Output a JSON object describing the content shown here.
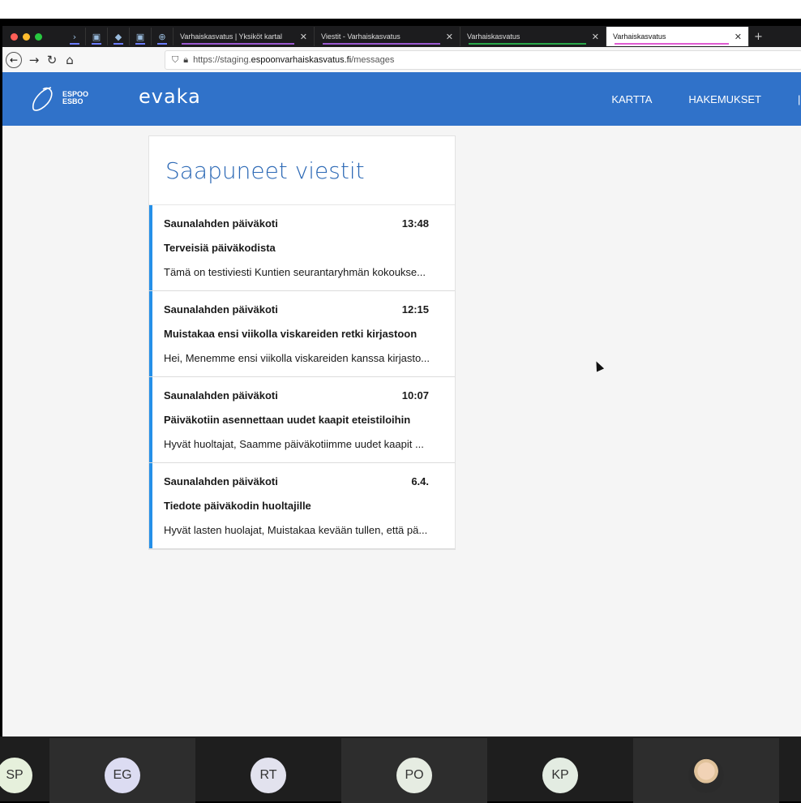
{
  "browser": {
    "tabs": [
      {
        "title": "Varhaiskasvatus | Yksiköt kartal",
        "close": "✕",
        "underline": "#9b59d0"
      },
      {
        "title": "Viestit - Varhaiskasvatus",
        "close": "✕",
        "underline": "#9b59d0"
      },
      {
        "title": "Varhaiskasvatus",
        "close": "✕",
        "underline": "#2aa84a"
      },
      {
        "title": "Varhaiskasvatus",
        "close": "✕",
        "underline": "#e05bd2",
        "active": true
      }
    ],
    "new_tab": "+",
    "url_prefix": "https://staging.",
    "url_domain": "espoonvarhaiskasvatus.fi",
    "url_path": "/messages"
  },
  "app": {
    "logo_line1": "ESPOO",
    "logo_line2": "ESBO",
    "brand": "evaka",
    "nav": [
      "KARTTA",
      "HAKEMUKSET"
    ],
    "accent": "#3072c9"
  },
  "inbox": {
    "title": "Saapuneet viestit",
    "messages": [
      {
        "sender": "Saunalahden päiväkoti",
        "time": "13:48",
        "subject": "Terveisiä päiväkodista",
        "preview": "Tämä on testiviesti Kuntien seurantaryhmän kokoukse..."
      },
      {
        "sender": "Saunalahden päiväkoti",
        "time": "12:15",
        "subject": "Muistakaa ensi viikolla viskareiden retki kirjastoon",
        "preview": "Hei, Menemme ensi viikolla viskareiden kanssa kirjasto..."
      },
      {
        "sender": "Saunalahden päiväkoti",
        "time": "10:07",
        "subject": "Päiväkotiin asennettaan uudet kaapit eteistiloihin",
        "preview": "Hyvät huoltajat, Saamme päiväkotiimme uudet kaapit ..."
      },
      {
        "sender": "Saunalahden päiväkoti",
        "time": "6.4.",
        "subject": "Tiedote päiväkodin huoltajille",
        "preview": "Hyvät lasten huolajat, Muistakaa kevään tullen, että pä..."
      }
    ]
  },
  "participants": [
    {
      "initials": "SP",
      "color": "#e6f0dc"
    },
    {
      "initials": "EG",
      "color": "#dcdcf2"
    },
    {
      "initials": "RT",
      "color": "#e2e2ee"
    },
    {
      "initials": "PO",
      "color": "#e6ece2"
    },
    {
      "initials": "KP",
      "color": "#e3ece2"
    },
    {
      "initials": "",
      "color": "#2b2b2b",
      "photo": true
    }
  ]
}
